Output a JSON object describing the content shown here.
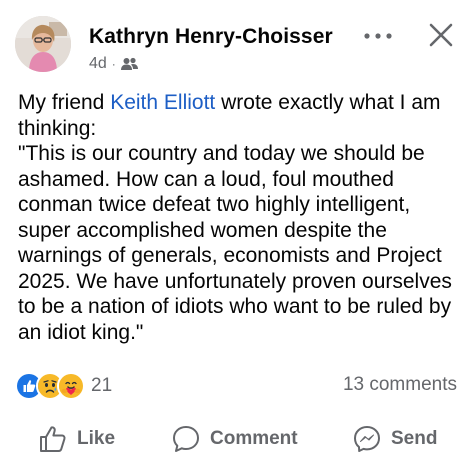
{
  "post": {
    "author": "Kathryn Henry-Choisser",
    "time": "4d",
    "separator": "·",
    "audience_icon": "friends-icon",
    "body": {
      "line1_prefix": "My friend ",
      "mention": "Keith Elliott",
      "line1_suffix": " wrote exactly what I am thinking:",
      "quote": "\"This is our country and today we should be ashamed. How can a loud, foul mouthed conman twice defeat two highly intelligent, super accomplished women despite the warnings of generals, economists and Project 2025. We have unfortunately proven ourselves to be a nation of idiots who want to be ruled by an idiot king.\""
    },
    "reactions": {
      "icons": [
        "like-reaction-icon",
        "sad-reaction-icon",
        "care-reaction-icon"
      ],
      "count": "21"
    },
    "comments_count": "13 comments",
    "actions": {
      "like": "Like",
      "comment": "Comment",
      "send": "Send"
    }
  },
  "colors": {
    "link": "#1d5ec5",
    "secondary_text": "#65676b",
    "like_blue": "#1b74e4",
    "emoji_yellow": "#f7b928"
  }
}
